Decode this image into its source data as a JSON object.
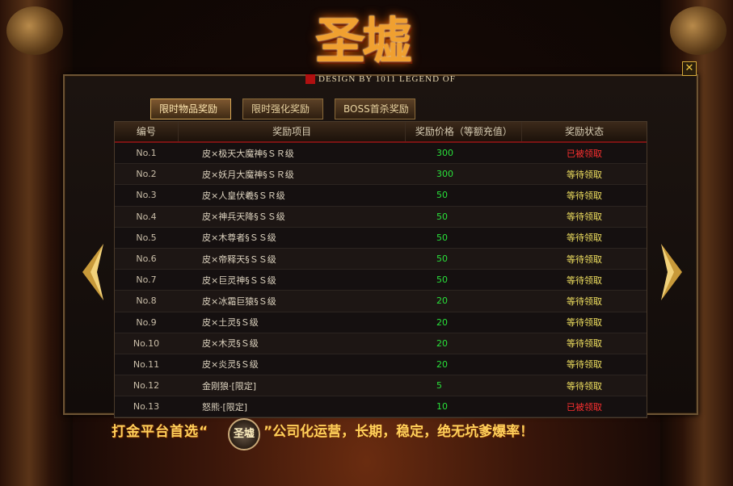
{
  "logo": {
    "main": "圣墟",
    "subtitle": "DESIGN BY 1011 LEGEND OF"
  },
  "close_label": "✕",
  "tabs": [
    {
      "label": "限时物品奖励",
      "active": true
    },
    {
      "label": "限时强化奖励",
      "active": false
    },
    {
      "label": "BOSS首杀奖励",
      "active": false
    }
  ],
  "table": {
    "headers": [
      "编号",
      "奖励项目",
      "奖励价格（等额充值）",
      "奖励状态"
    ],
    "rows": [
      {
        "no": "No.1",
        "item": "皮×极天大魔神§ＳＲ级",
        "price": "300",
        "status": "已被领取"
      },
      {
        "no": "No.2",
        "item": "皮×妖月大魔神§ＳＲ级",
        "price": "300",
        "status": "等待领取"
      },
      {
        "no": "No.3",
        "item": "皮×人皇伏羲§ＳＲ级",
        "price": "50",
        "status": "等待领取"
      },
      {
        "no": "No.4",
        "item": "皮×神兵天降§ＳＳ级",
        "price": "50",
        "status": "等待领取"
      },
      {
        "no": "No.5",
        "item": "皮×木尊者§ＳＳ级",
        "price": "50",
        "status": "等待领取"
      },
      {
        "no": "No.6",
        "item": "皮×帝释天§ＳＳ级",
        "price": "50",
        "status": "等待领取"
      },
      {
        "no": "No.7",
        "item": "皮×巨灵神§ＳＳ级",
        "price": "50",
        "status": "等待领取"
      },
      {
        "no": "No.8",
        "item": "皮×冰霜巨猿§Ｓ级",
        "price": "20",
        "status": "等待领取"
      },
      {
        "no": "No.9",
        "item": "皮×土灵§Ｓ级",
        "price": "20",
        "status": "等待领取"
      },
      {
        "no": "No.10",
        "item": "皮×木灵§Ｓ级",
        "price": "20",
        "status": "等待领取"
      },
      {
        "no": "No.11",
        "item": "皮×炎灵§Ｓ级",
        "price": "20",
        "status": "等待领取"
      },
      {
        "no": "No.12",
        "item": "金刚狼·[限定]",
        "price": "5",
        "status": "等待领取"
      },
      {
        "no": "No.13",
        "item": "怒熊·[限定]",
        "price": "10",
        "status": "已被领取"
      }
    ]
  },
  "banner": {
    "part1": "打金平台首选“",
    "logo": "圣墟",
    "part2": "”公司化运营，长期，稳定，绝无坑爹爆率！"
  },
  "colors": {
    "claimed": "#ff3030",
    "waiting": "#f0e060",
    "price": "#29e03a",
    "accent_gold": "#d4a454"
  }
}
